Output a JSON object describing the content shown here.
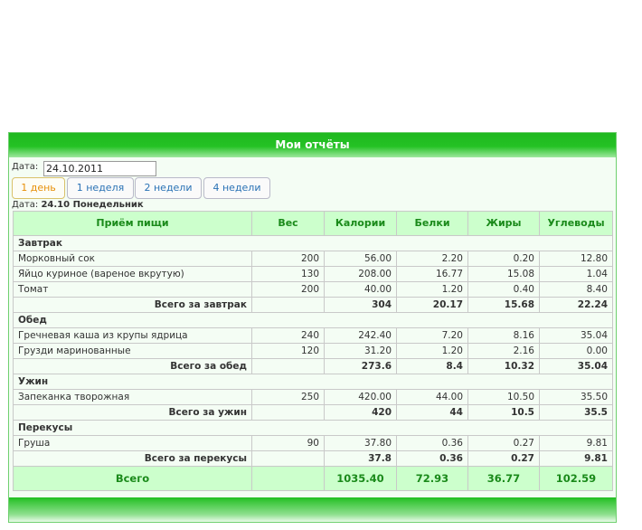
{
  "panel": {
    "title": "Мои отчёты"
  },
  "date_field": {
    "label": "Дата:",
    "value": "24.10.2011"
  },
  "tabs": [
    {
      "label": "1 день",
      "active": true
    },
    {
      "label": "1 неделя",
      "active": false
    },
    {
      "label": "2 недели",
      "active": false
    },
    {
      "label": "4 недели",
      "active": false
    }
  ],
  "report_date": {
    "label": "Дата:",
    "value": "24.10 Понедельник"
  },
  "table": {
    "columns": [
      "Приём пищи",
      "Вес",
      "Калории",
      "Белки",
      "Жиры",
      "Углеводы"
    ],
    "meals": [
      {
        "name": "Завтрак",
        "items": [
          [
            "Морковный сок",
            "200",
            "56.00",
            "2.20",
            "0.20",
            "12.80"
          ],
          [
            "Яйцо куриное (вареное вкрутую)",
            "130",
            "208.00",
            "16.77",
            "15.08",
            "1.04"
          ],
          [
            "Томат",
            "200",
            "40.00",
            "1.20",
            "0.40",
            "8.40"
          ]
        ],
        "subtotal": [
          "Всего за завтрак",
          "",
          "304",
          "20.17",
          "15.68",
          "22.24"
        ]
      },
      {
        "name": "Обед",
        "items": [
          [
            "Гречневая каша из крупы ядрица",
            "240",
            "242.40",
            "7.20",
            "8.16",
            "35.04"
          ],
          [
            "Грузди маринованные",
            "120",
            "31.20",
            "1.20",
            "2.16",
            "0.00"
          ]
        ],
        "subtotal": [
          "Всего за обед",
          "",
          "273.6",
          "8.4",
          "10.32",
          "35.04"
        ]
      },
      {
        "name": "Ужин",
        "items": [
          [
            "Запеканка творожная",
            "250",
            "420.00",
            "44.00",
            "10.50",
            "35.50"
          ]
        ],
        "subtotal": [
          "Всего за ужин",
          "",
          "420",
          "44",
          "10.5",
          "35.5"
        ]
      },
      {
        "name": "Перекусы",
        "items": [
          [
            "Груша",
            "90",
            "37.80",
            "0.36",
            "0.27",
            "9.81"
          ]
        ],
        "subtotal": [
          "Всего за перекусы",
          "",
          "37.8",
          "0.36",
          "0.27",
          "9.81"
        ]
      }
    ],
    "grand_total": [
      "Всего",
      "",
      "1035.40",
      "72.93",
      "36.77",
      "102.59"
    ]
  },
  "colors": {
    "accent_green": "#1fb81f",
    "header_bg": "#ccffcc",
    "header_text": "#1a8a1a",
    "tab_link": "#2a72b5",
    "tab_active": "#e78f08"
  }
}
